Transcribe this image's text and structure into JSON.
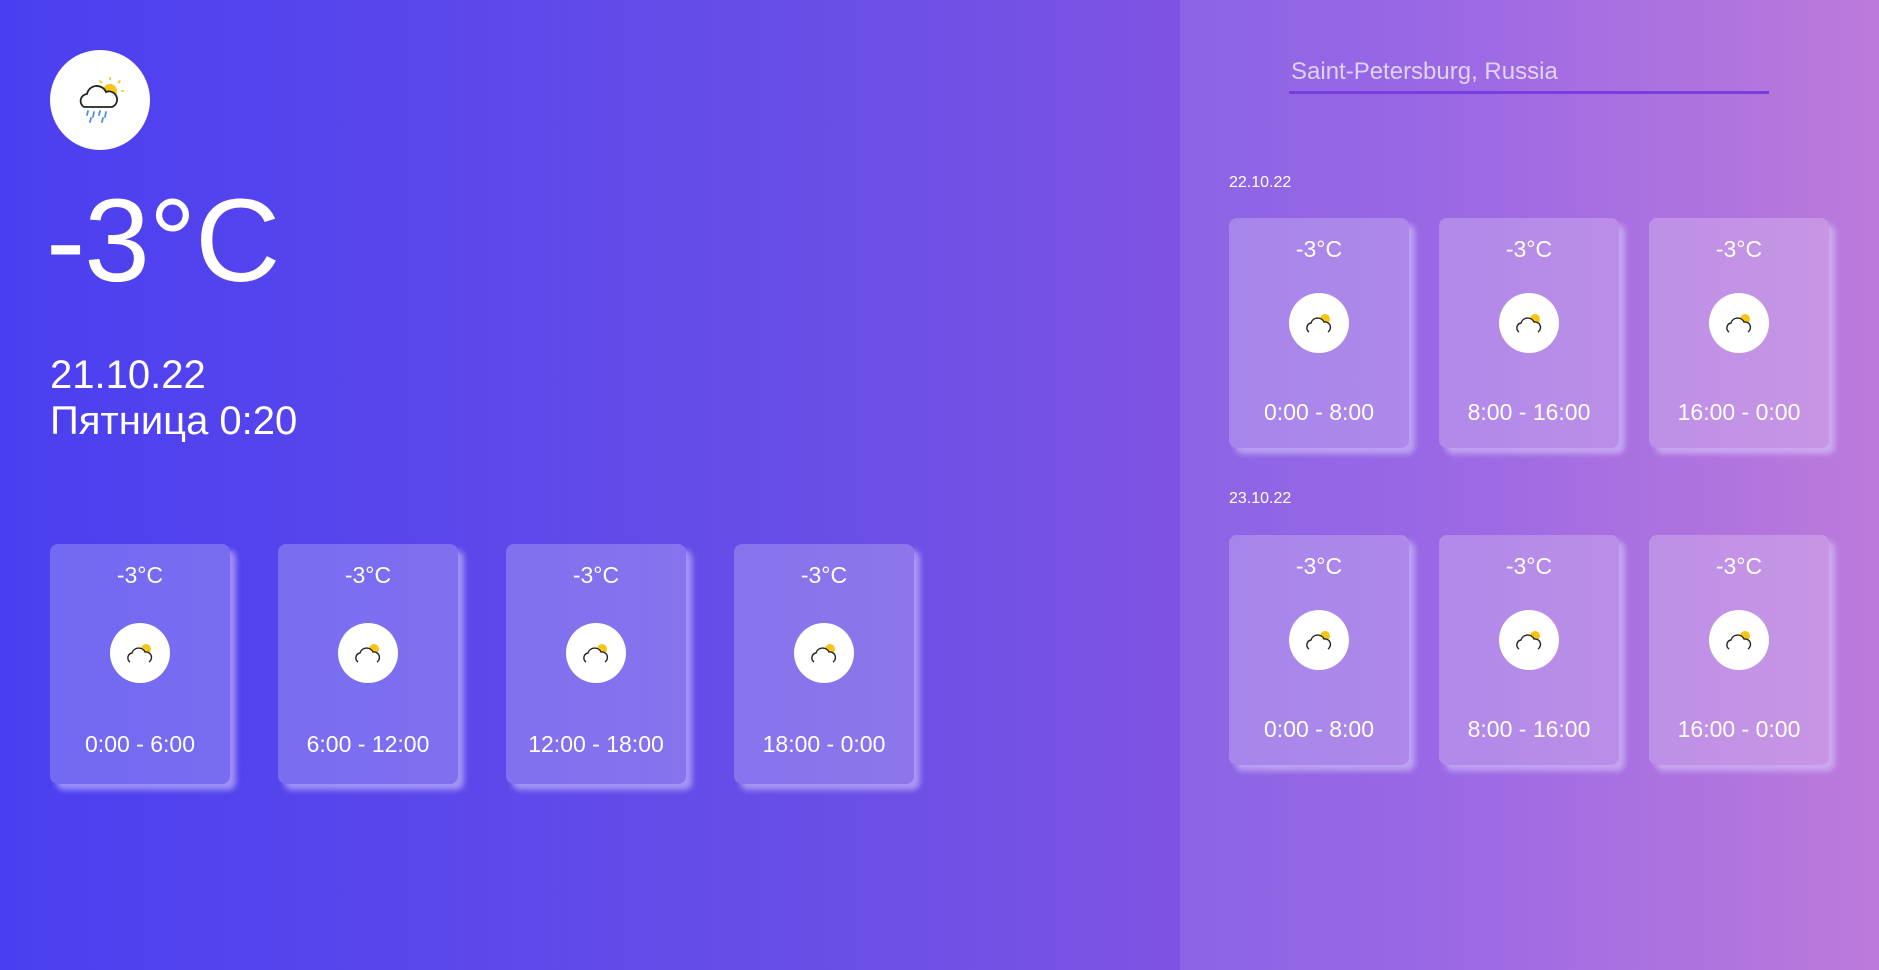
{
  "current": {
    "icon": "cloud-rain-sun-icon",
    "temperature": "-3°C",
    "date": "21.10.22",
    "day_time": "Пятница 0:20"
  },
  "hourly": [
    {
      "temp": "-3°C",
      "period": "0:00 - 6:00",
      "icon": "cloud-sun-icon"
    },
    {
      "temp": "-3°C",
      "period": "6:00 - 12:00",
      "icon": "cloud-sun-icon"
    },
    {
      "temp": "-3°C",
      "period": "12:00 - 18:00",
      "icon": "cloud-sun-icon"
    },
    {
      "temp": "-3°C",
      "period": "18:00 - 0:00",
      "icon": "cloud-sun-icon"
    }
  ],
  "search": {
    "placeholder": "Saint-Petersburg, Russia"
  },
  "forecast": [
    {
      "date": "22.10.22",
      "periods": [
        {
          "temp": "-3°C",
          "period": "0:00 - 8:00",
          "icon": "cloud-sun-icon"
        },
        {
          "temp": "-3°C",
          "period": "8:00 - 16:00",
          "icon": "cloud-sun-icon"
        },
        {
          "temp": "-3°C",
          "period": "16:00 - 0:00",
          "icon": "cloud-sun-icon"
        }
      ]
    },
    {
      "date": "23.10.22",
      "periods": [
        {
          "temp": "-3°C",
          "period": "0:00 - 8:00",
          "icon": "cloud-sun-icon"
        },
        {
          "temp": "-3°C",
          "period": "8:00 - 16:00",
          "icon": "cloud-sun-icon"
        },
        {
          "temp": "-3°C",
          "period": "16:00 - 0:00",
          "icon": "cloud-sun-icon"
        }
      ]
    }
  ],
  "colors": {
    "gradient_start": "#4a3ff0",
    "gradient_end": "#b56cd8",
    "search_underline": "#7a3ee0",
    "sun": "#f6c518",
    "rain": "#4a90d9"
  }
}
